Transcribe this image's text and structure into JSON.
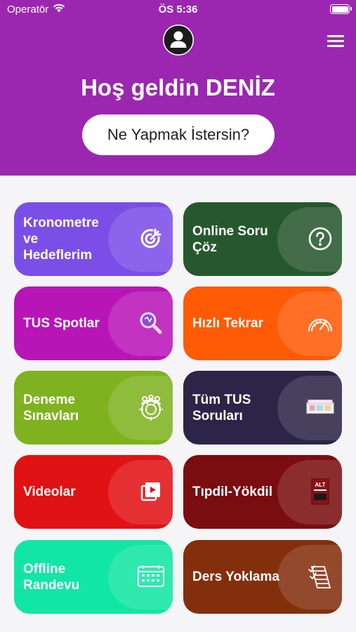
{
  "status_bar": {
    "carrier": "Operatör",
    "time": "ÖS 5:36"
  },
  "header": {
    "welcome": "Hoş geldin DENİZ",
    "prompt_button": "Ne Yapmak İstersin?",
    "background_color": "#9b27b0"
  },
  "menu": [
    {
      "id": "kronometre",
      "label": "Kronometre\nve\nHedeflerim",
      "icon": "target-icon",
      "color": "#7b4ee8"
    },
    {
      "id": "online-soru",
      "label": "Online Soru\nÇöz",
      "icon": "question-circle-icon",
      "color": "#27582d"
    },
    {
      "id": "tus-spotlar",
      "label": "TUS Spotlar",
      "icon": "magnifier-icon",
      "color": "#b815b7"
    },
    {
      "id": "hizli-tekrar",
      "label": "Hızlı Tekrar",
      "icon": "speedometer-icon",
      "color": "#ff5a06"
    },
    {
      "id": "deneme",
      "label": "Deneme\nSınavları",
      "icon": "group-target-icon",
      "color": "#7fb21f"
    },
    {
      "id": "tum-tus",
      "label": "Tüm TUS\nSoruları",
      "icon": "book-stack-icon",
      "color": "#2c2547"
    },
    {
      "id": "videolar",
      "label": "Videolar",
      "icon": "video-play-icon",
      "color": "#e11214"
    },
    {
      "id": "tipdil",
      "label": "Tıpdil-Yökdil",
      "icon": "book-cover-icon",
      "color": "#7a0d10"
    },
    {
      "id": "offline-randevu",
      "label": "Offline\nRandevu",
      "icon": "calendar-icon",
      "color": "#12e6a4"
    },
    {
      "id": "ders-yoklama",
      "label": "Ders Yoklama",
      "icon": "checklist-icon",
      "color": "#832f0c"
    }
  ]
}
